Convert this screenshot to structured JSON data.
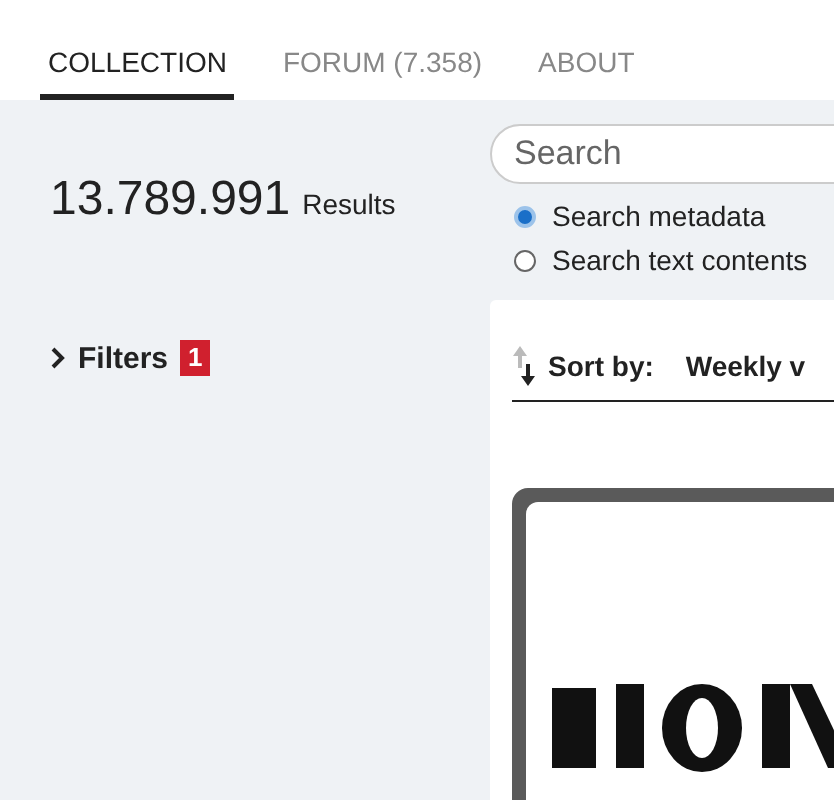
{
  "tabs": [
    {
      "label": "COLLECTION",
      "selected": true
    },
    {
      "label": "FORUM (7.358)",
      "selected": false
    },
    {
      "label": "ABOUT",
      "selected": false
    }
  ],
  "results": {
    "count": "13.789.991",
    "label": "Results"
  },
  "filters": {
    "label": "Filters",
    "badge": "1",
    "expanded": false
  },
  "search": {
    "placeholder": "Search"
  },
  "search_options": [
    {
      "label": "Search metadata",
      "selected": true
    },
    {
      "label": "Search text contents",
      "selected": false
    }
  ],
  "sort": {
    "label": "Sort by:",
    "value": "Weekly v"
  }
}
